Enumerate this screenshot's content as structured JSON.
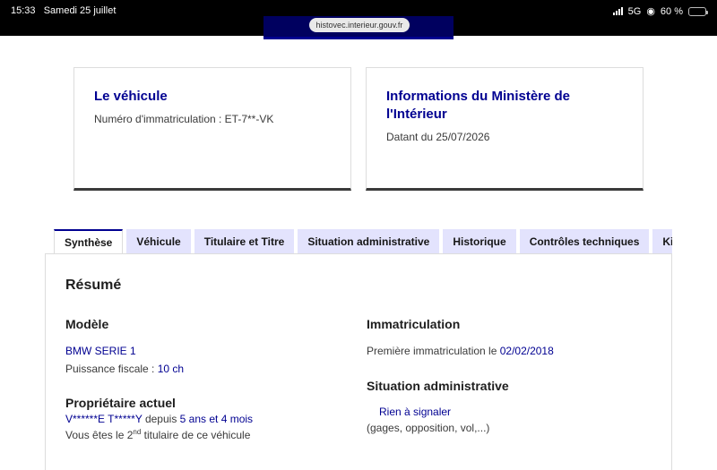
{
  "status_bar": {
    "time": "15:33",
    "date": "Samedi 25 juillet",
    "network": "5G",
    "battery": "60 %",
    "battery_level": 0.6
  },
  "browser": {
    "url": "histovec.interieur.gouv.fr"
  },
  "cards": {
    "vehicle": {
      "title": "Le véhicule",
      "plate_text": "Numéro d'immatriculation : ET-7**-VK"
    },
    "ministry": {
      "title_line1": "Informations du Ministère de",
      "title_line2": "l'Intérieur",
      "date_text": "Datant du 25/07/2026"
    }
  },
  "tabs": [
    {
      "label": "Synthèse",
      "active": true
    },
    {
      "label": "Véhicule"
    },
    {
      "label": "Titulaire et Titre"
    },
    {
      "label": "Situation administrative"
    },
    {
      "label": "Historique"
    },
    {
      "label": "Contrôles techniques"
    },
    {
      "label": "Kilo"
    }
  ],
  "summary": {
    "title": "Résumé",
    "model": {
      "heading": "Modèle",
      "name": "BMW SERIE 1",
      "power_label": "Puissance fiscale : ",
      "power_value": "10 ch"
    },
    "owner": {
      "heading": "Propriétaire actuel",
      "name": "V******E T*****Y",
      "since_label": " depuis ",
      "since_value": "5 ans et 4 mois",
      "rank_prefix": "Vous êtes le 2",
      "rank_sup": "nd",
      "rank_suffix": " titulaire de ce véhicule"
    },
    "registration": {
      "heading": "Immatriculation",
      "first_label": "Première immatriculation le ",
      "first_value": "02/02/2018"
    },
    "admin": {
      "heading": "Situation administrative",
      "status": "Rien à signaler",
      "details": "(gages, opposition, vol,...)"
    }
  }
}
